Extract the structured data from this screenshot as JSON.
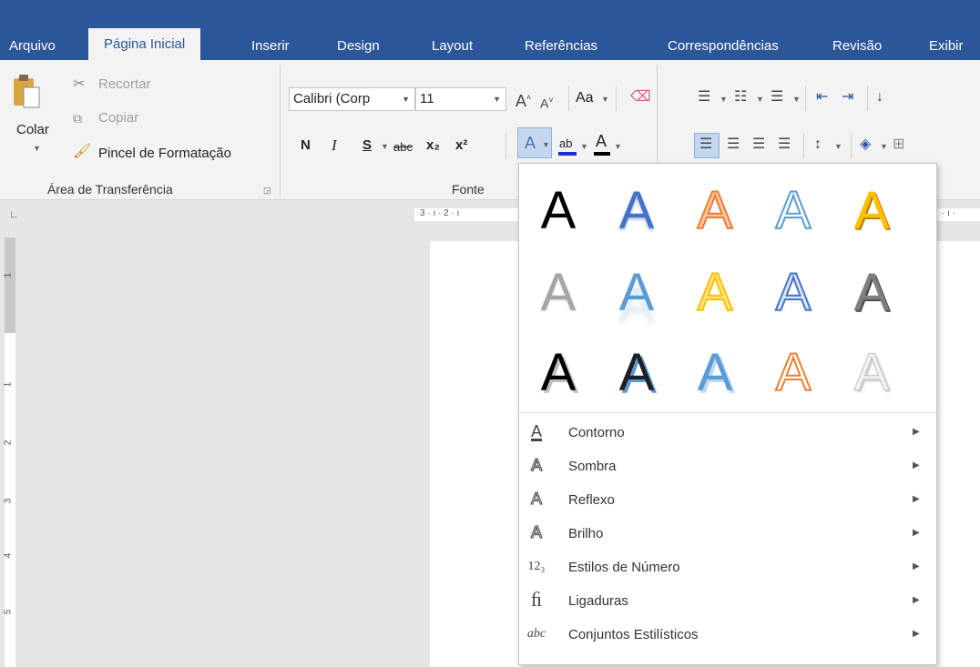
{
  "tabs": [
    {
      "label": "Arquivo"
    },
    {
      "label": "Página Inicial"
    },
    {
      "label": "Inserir"
    },
    {
      "label": "Design"
    },
    {
      "label": "Layout"
    },
    {
      "label": "Referências"
    },
    {
      "label": "Correspondências"
    },
    {
      "label": "Revisão"
    },
    {
      "label": "Exibir"
    }
  ],
  "clipboard": {
    "paste_label": "Colar",
    "cut_label": "Recortar",
    "copy_label": "Copiar",
    "format_painter_label": "Pincel de Formatação",
    "group_label": "Área de Transferência"
  },
  "font": {
    "font_name": "Calibri (Corp",
    "font_size": "11",
    "change_case_label": "Aa",
    "bold": "N",
    "italic": "I",
    "underline": "S",
    "strike": "abc",
    "subscript": "x₂",
    "superscript": "x²",
    "group_label": "Fonte"
  },
  "ruler": {
    "h_text": "3 · ı · 2 · ı",
    "h_text_right": "· ı ·",
    "v_numbers": [
      "1",
      "1",
      "2",
      "3",
      "4",
      "5"
    ]
  },
  "effects_gallery": {
    "glyph": "A",
    "colors": {
      "black": "#000000",
      "blue": "#4472c4",
      "orange": "#ed7d31",
      "gold": "#ffc000",
      "gray": "#7f7f7f",
      "light_blue": "#5b9bd5"
    }
  },
  "menu": {
    "items": [
      {
        "label": "Contorno",
        "icon": "outline-icon",
        "glyph": "A"
      },
      {
        "label": "Sombra",
        "icon": "shadow-icon",
        "glyph": "A"
      },
      {
        "label": "Reflexo",
        "icon": "reflection-icon",
        "glyph": "A"
      },
      {
        "label": "Brilho",
        "icon": "glow-icon",
        "glyph": "A"
      },
      {
        "label": "Estilos de Número",
        "icon": "number-styles-icon",
        "glyph": "12₃"
      },
      {
        "label": "Ligaduras",
        "icon": "ligatures-icon",
        "glyph": "ﬁ"
      },
      {
        "label": "Conjuntos Estilísticos",
        "icon": "stylistic-sets-icon",
        "glyph": "abc"
      }
    ]
  }
}
